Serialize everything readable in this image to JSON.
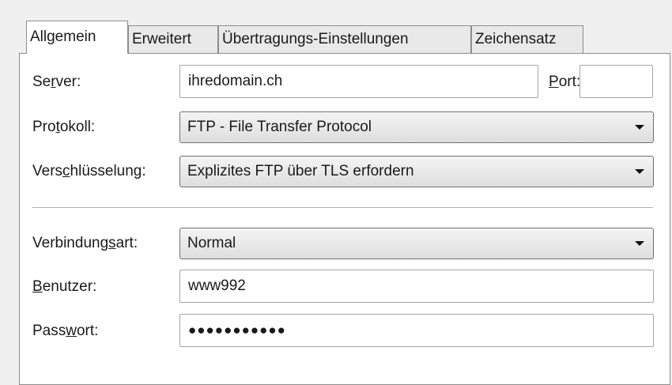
{
  "tabs": [
    "Allgemein",
    "Erweitert",
    "Übertragungs-Einstellungen",
    "Zeichensatz"
  ],
  "labels": {
    "server": [
      "Se",
      "r",
      "ver:"
    ],
    "port": [
      "",
      "P",
      "ort:"
    ],
    "protokoll": [
      "Pro",
      "t",
      "okoll:"
    ],
    "verschluesselung": [
      "Vers",
      "c",
      "hlüsselung:"
    ],
    "verbindungsart": [
      "Verbindung",
      "s",
      "art:"
    ],
    "benutzer": [
      "",
      "B",
      "enutzer:"
    ],
    "passwort": [
      "Pass",
      "w",
      "ort:"
    ]
  },
  "values": {
    "server": "ihredomain.ch",
    "port": "",
    "protokoll": "FTP - File Transfer Protocol",
    "verschluesselung": "Explizites FTP über TLS erfordern",
    "verbindungsart": "Normal",
    "benutzer": "www992",
    "passwort": "●●●●●●●●●●●"
  },
  "icons": {
    "dropdown": "chevron-down-icon"
  }
}
